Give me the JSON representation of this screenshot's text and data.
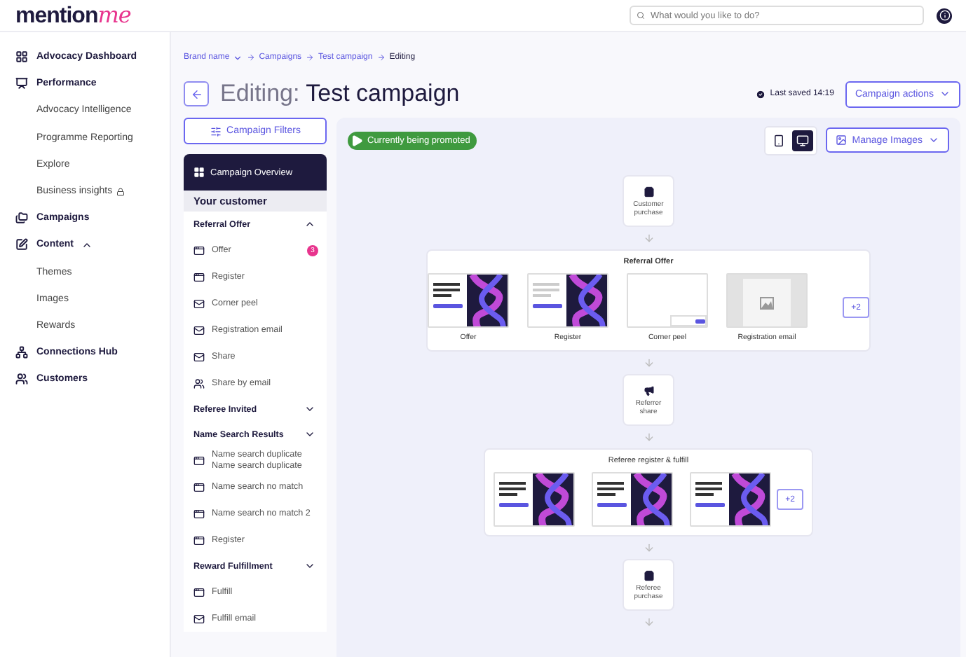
{
  "header": {
    "logo_main": "mention",
    "logo_script": "me",
    "search": {
      "placeholder": "What would you like to do?"
    }
  },
  "nav": [
    {
      "label": "Advocacy Dashboard"
    },
    {
      "label": "Performance",
      "children": [
        {
          "label": "Advocacy Intelligence",
          "locked": false
        },
        {
          "label": "Programme Reporting",
          "locked": false
        },
        {
          "label": "Explore",
          "locked": false
        },
        {
          "label": "Business insights",
          "locked": true
        }
      ]
    },
    {
      "label": "Campaigns"
    },
    {
      "label": "Content",
      "expanded": true,
      "children": [
        {
          "label": "Themes",
          "locked": false
        },
        {
          "label": "Images",
          "locked": false
        },
        {
          "label": "Rewards",
          "locked": false
        }
      ]
    },
    {
      "label": "Connections Hub"
    },
    {
      "label": "Customers"
    }
  ],
  "breadcrumb": [
    {
      "label": "Brand name",
      "dropdown": true,
      "current": false
    },
    {
      "label": "Campaigns",
      "dropdown": false,
      "current": false
    },
    {
      "label": "Test campaign",
      "dropdown": false,
      "current": false
    },
    {
      "label": "Editing",
      "dropdown": false,
      "current": true
    }
  ],
  "title": {
    "prefix": "Editing:",
    "name": "Test campaign"
  },
  "saved": "Last saved 14:19",
  "actions_button": "Campaign actions",
  "filters_button": "Campaign Filters",
  "overview": {
    "title": "Campaign Overview",
    "group": "Your customer",
    "sections": [
      {
        "title": "Referral Offer",
        "expanded": true,
        "items": [
          {
            "label": "Offer",
            "kind": "page",
            "badge": "3"
          },
          {
            "label": "Register",
            "kind": "page"
          },
          {
            "label": "Corner peel",
            "kind": "email"
          },
          {
            "label": "Registration email",
            "kind": "email"
          },
          {
            "label": "Share",
            "kind": "email"
          },
          {
            "label": "Share by email",
            "kind": "share"
          }
        ]
      },
      {
        "title": "Referee Invited",
        "expanded": false
      },
      {
        "title": "Name Search Results",
        "expanded": false,
        "items": [
          {
            "label": "Name search duplicate Name search duplicate",
            "kind": "page"
          },
          {
            "label": "Name search no match",
            "kind": "page"
          },
          {
            "label": "Name search no match 2",
            "kind": "page"
          },
          {
            "label": "Register",
            "kind": "page"
          }
        ]
      },
      {
        "title": "Reward Fulfillment",
        "expanded": false,
        "items": [
          {
            "label": "Fulfill",
            "kind": "page"
          },
          {
            "label": "Fulfill email",
            "kind": "email"
          }
        ]
      }
    ]
  },
  "status": "Currently being promoted",
  "devices": [
    {
      "kind": "mobile",
      "selected": false
    },
    {
      "kind": "desktop",
      "selected": true
    }
  ],
  "manage_images": "Manage Images",
  "flow": [
    {
      "kind": "purchase",
      "label": "Customer purchase"
    },
    {
      "kind": "group",
      "title": "Referral Offer",
      "more": "+2",
      "previews": [
        {
          "kind": "promo",
          "label": "Offer"
        },
        {
          "kind": "form",
          "label": "Register"
        },
        {
          "kind": "blank",
          "label": "Corner peel"
        },
        {
          "kind": "email",
          "label": "Registration email"
        }
      ]
    },
    {
      "kind": "share",
      "label": "Referrer share"
    },
    {
      "kind": "group",
      "title": "Referee register & fulfill",
      "more": "+2",
      "previews": [
        {
          "kind": "promo"
        },
        {
          "kind": "promo"
        },
        {
          "kind": "promo"
        }
      ]
    },
    {
      "kind": "purchase",
      "label": "Referee purchase"
    }
  ]
}
